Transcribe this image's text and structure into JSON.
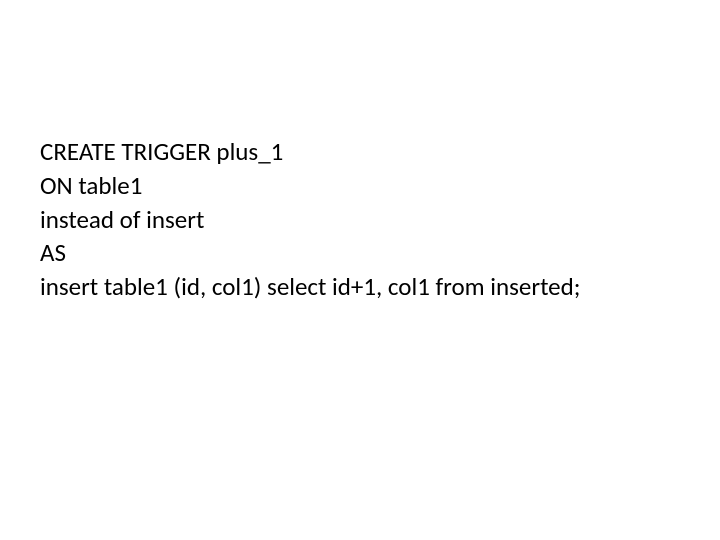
{
  "code": {
    "line1": "CREATE TRIGGER plus_1",
    "line2": "ON table1",
    "line3": "instead of insert",
    "line4": "AS",
    "line5": "insert table1 (id, col1)  select id+1, col1 from inserted;"
  }
}
